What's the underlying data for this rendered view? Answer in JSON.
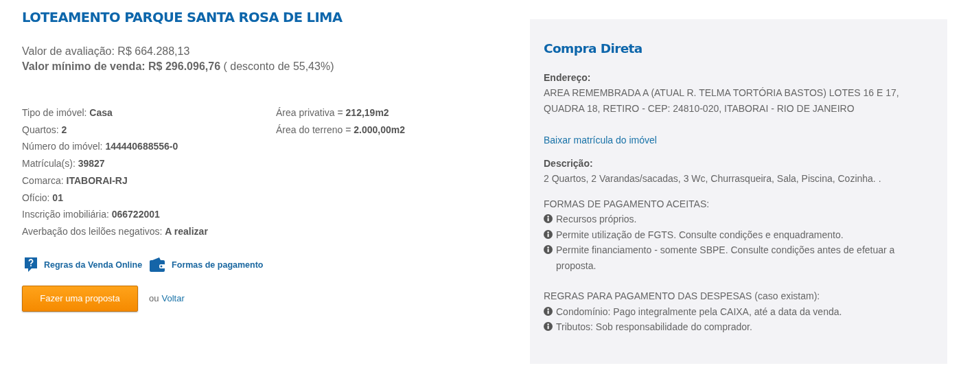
{
  "title": "LOTEAMENTO PARQUE SANTA ROSA DE LIMA",
  "valuation": {
    "label": "Valor de avaliação:",
    "value": "R$ 664.288,13"
  },
  "minimum": {
    "label": "Valor mínimo de venda:",
    "value": "R$ 296.096,76",
    "note": "( desconto de 55,43%)"
  },
  "details": [
    {
      "label": "Tipo de imóvel:",
      "value": "Casa"
    },
    {
      "label": "Quartos:",
      "value": "2"
    },
    {
      "label": "Número do imóvel:",
      "value": "144440688556-0"
    },
    {
      "label": "Matrícula(s):",
      "value": "39827"
    },
    {
      "label": "Comarca:",
      "value": "ITABORAI-RJ"
    },
    {
      "label": "Ofício:",
      "value": "01"
    },
    {
      "label": "Inscrição imobiliária:",
      "value": "066722001"
    },
    {
      "label": "Averbação dos leilões negativos:",
      "value": "A realizar"
    }
  ],
  "areas": [
    {
      "label": "Área privativa =",
      "value": "212,19m2"
    },
    {
      "label": "Área do terreno =",
      "value": "2.000,00m2"
    }
  ],
  "links": [
    {
      "kind": "question",
      "label": "Regras da Venda Online"
    },
    {
      "kind": "wallet",
      "label": "Formas de pagamento"
    }
  ],
  "proposal_button": "Fazer uma proposta",
  "or_text": "ou",
  "back_link": "Voltar",
  "panel": {
    "title": "Compra Direta",
    "address_label": "Endereço:",
    "address": "AREA REMEMBRADA A (ATUAL R. TELMA TORTÓRIA BASTOS) LOTES 16 E 17, QUADRA 18, RETIRO - CEP: 24810-020, ITABORAI - RIO DE JANEIRO",
    "download_link": "Baixar matrícula do imóvel",
    "description_label": "Descrição:",
    "description": "2 Quartos, 2 Varandas/sacadas, 3 Wc, Churrasqueira, Sala, Piscina, Cozinha. .",
    "sections": [
      {
        "heading": "FORMAS DE PAGAMENTO ACEITAS:",
        "items": [
          "Recursos próprios.",
          "Permite utilização de FGTS. Consulte condições e enquadramento.",
          "Permite financiamento - somente SBPE. Consulte condições antes de efetuar a proposta."
        ]
      },
      {
        "heading": "REGRAS PARA PAGAMENTO DAS DESPESAS (caso existam):",
        "items": [
          "Condomínio: Pago integralmente pela CAIXA, até a data da venda.",
          "Tributos: Sob responsabilidade do comprador."
        ]
      }
    ]
  }
}
